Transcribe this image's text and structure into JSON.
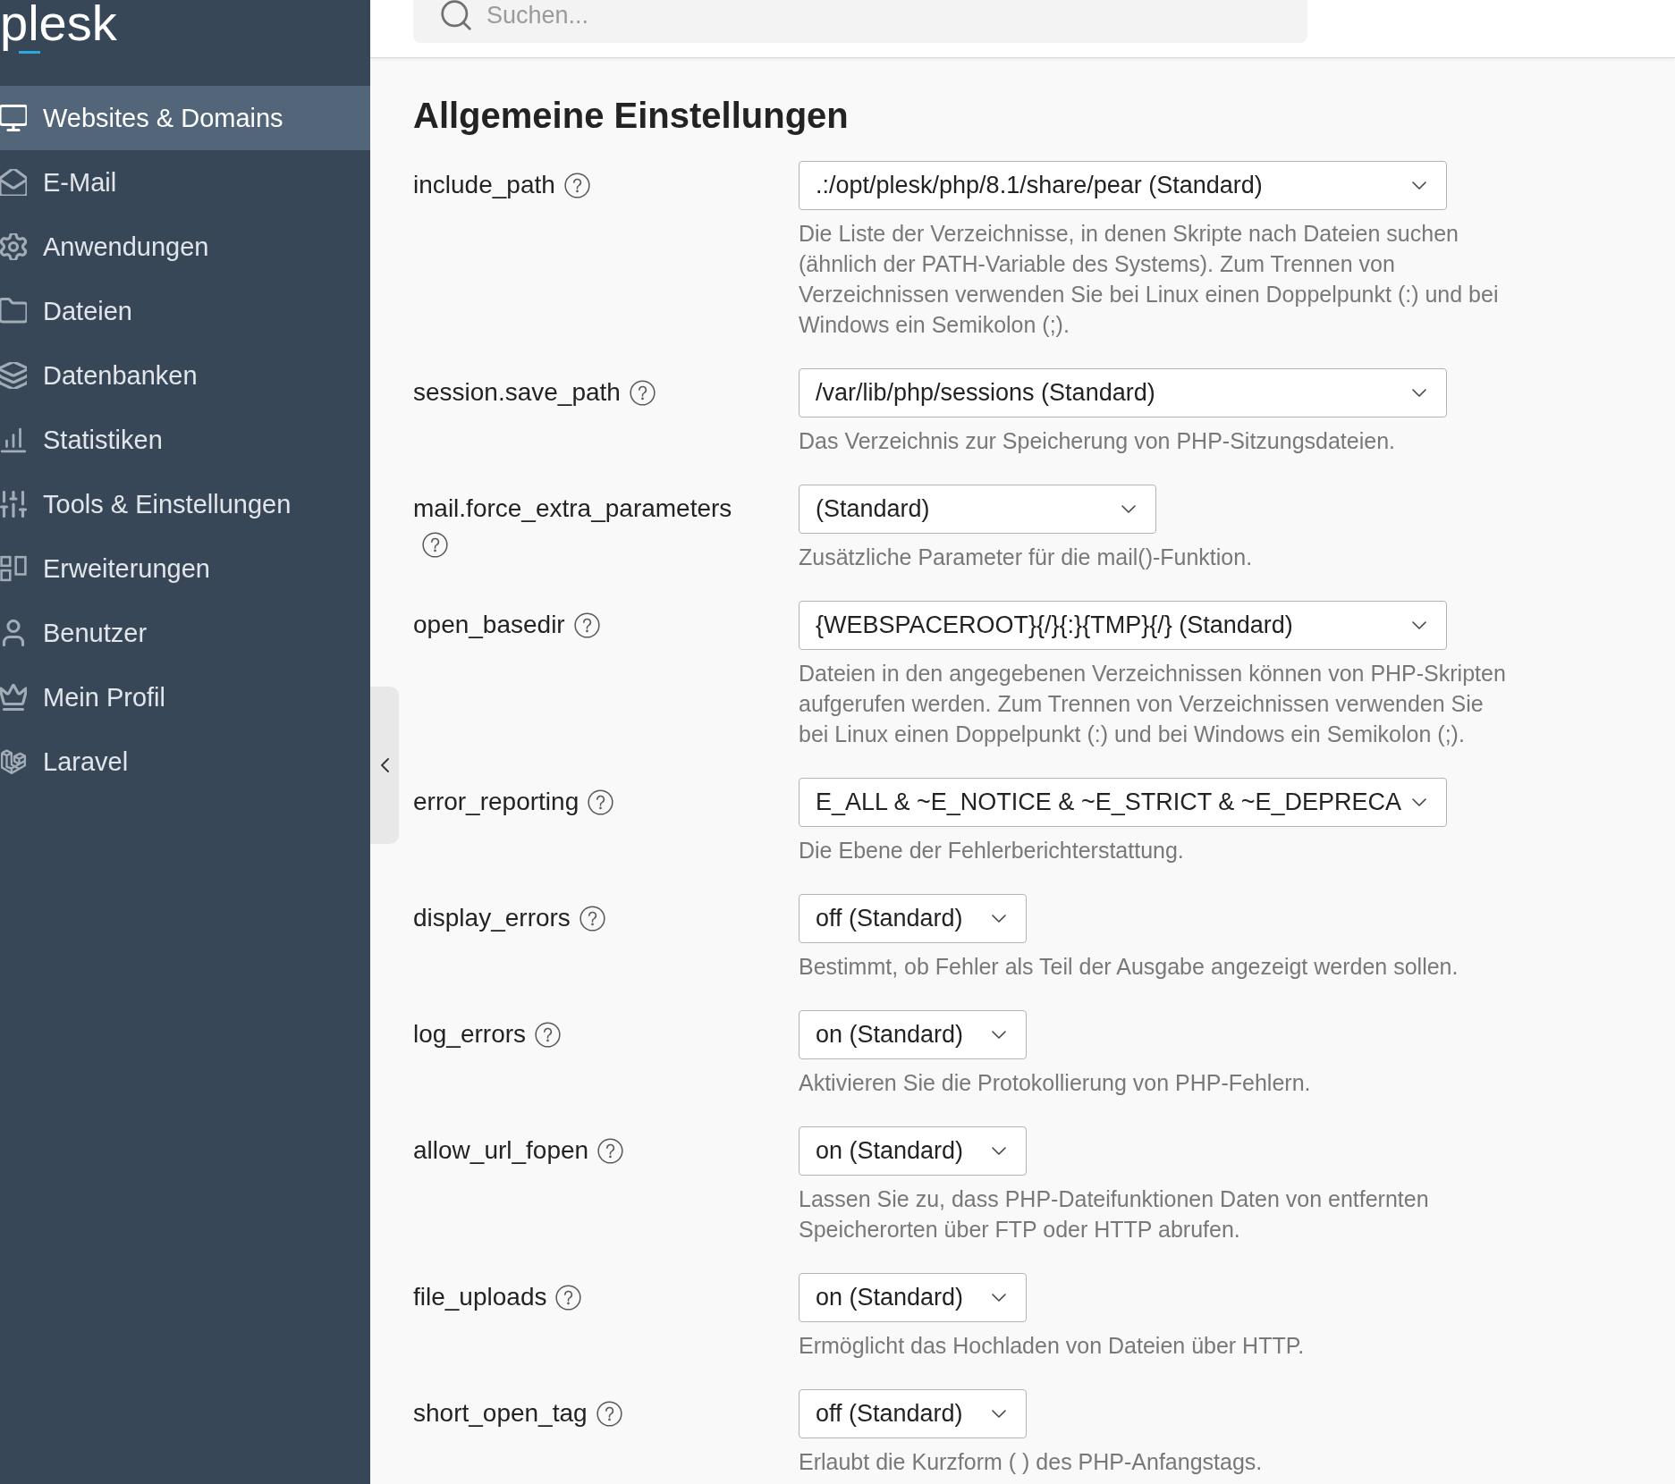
{
  "logo": {
    "text": "plesk"
  },
  "sidebar": {
    "items": [
      {
        "label": "Websites & Domains",
        "selected": true
      },
      {
        "label": "E-Mail",
        "selected": false
      },
      {
        "label": "Anwendungen",
        "selected": false
      },
      {
        "label": "Dateien",
        "selected": false
      },
      {
        "label": "Datenbanken",
        "selected": false
      },
      {
        "label": "Statistiken",
        "selected": false
      },
      {
        "label": "Tools & Einstellungen",
        "selected": false
      },
      {
        "label": "Erweiterungen",
        "selected": false
      },
      {
        "label": "Benutzer",
        "selected": false
      },
      {
        "label": "Mein Profil",
        "selected": false
      },
      {
        "label": "Laravel",
        "selected": false
      }
    ]
  },
  "search": {
    "placeholder": "Suchen..."
  },
  "section": {
    "title": "Allgemeine Einstellungen",
    "settings": [
      {
        "name": "include_path",
        "kind": "path",
        "value": ".:/opt/plesk/php/8.1/share/pear (Standard)",
        "description": "Die Liste der Verzeichnisse, in denen Skripte nach Dateien suchen (ähnlich der PATH-Variable des Systems). Zum Trennen von Verzeichnissen verwenden Sie bei Linux einen Doppelpunkt (:) und bei Windows ein Semikolon (;)."
      },
      {
        "name": "session.save_path",
        "kind": "path",
        "value": "/var/lib/php/sessions (Standard)",
        "description": "Das Verzeichnis zur Speicherung von PHP-Sitzungsdateien."
      },
      {
        "name": "mail.force_extra_parameters",
        "kind": "text",
        "value": "(Standard)",
        "description": "Zusätzliche Parameter für die mail()-Funktion."
      },
      {
        "name": "open_basedir",
        "kind": "path",
        "value": "{WEBSPACEROOT}{/}{:}{TMP}{/} (Standard)",
        "description": "Dateien in den angegebenen Verzeichnissen können von PHP-Skripten aufgerufen werden. Zum Trennen von Verzeichnissen verwenden Sie bei Linux einen Doppelpunkt (:) und bei Windows ein Semikolon (;)."
      },
      {
        "name": "error_reporting",
        "kind": "path",
        "value": "E_ALL & ~E_NOTICE & ~E_STRICT & ~E_DEPRECA",
        "description": "Die Ebene der Fehlerberichterstattung."
      },
      {
        "name": "display_errors",
        "kind": "flag",
        "value": "off (Standard)",
        "description": "Bestimmt, ob Fehler als Teil der Ausgabe angezeigt werden sollen."
      },
      {
        "name": "log_errors",
        "kind": "flag",
        "value": "on (Standard)",
        "description": "Aktivieren Sie die Protokollierung von PHP-Fehlern."
      },
      {
        "name": "allow_url_fopen",
        "kind": "flag",
        "value": "on (Standard)",
        "description": "Lassen Sie zu, dass PHP-Dateifunktionen Daten von entfernten Speicherorten über FTP oder HTTP abrufen."
      },
      {
        "name": "file_uploads",
        "kind": "flag",
        "value": "on (Standard)",
        "description": "Ermöglicht das Hochladen von Dateien über HTTP."
      },
      {
        "name": "short_open_tag",
        "kind": "flag",
        "value": "off (Standard)",
        "description": "Erlaubt die Kurzform ( ) des PHP-Anfangstags."
      }
    ]
  }
}
